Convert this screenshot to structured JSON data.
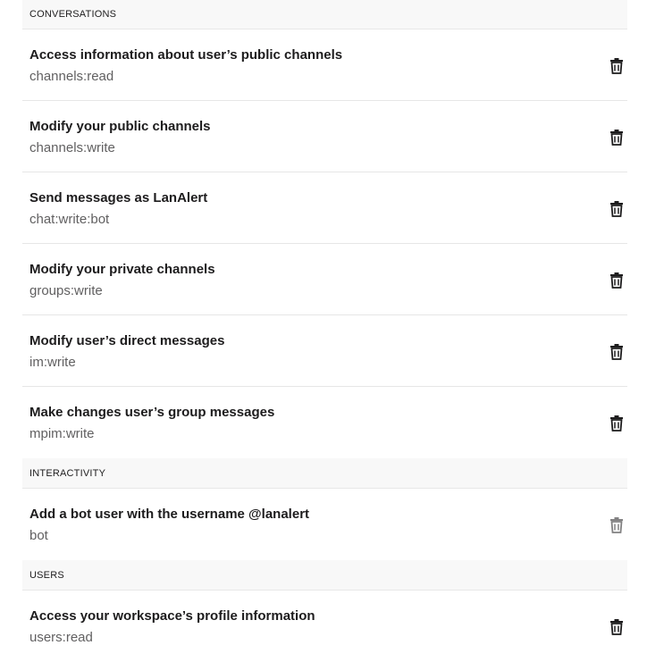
{
  "sections": [
    {
      "header": "CONVERSATIONS",
      "scopes": [
        {
          "title": "Access information about user’s public channels",
          "id": "channels:read",
          "icon": "trash-icon"
        },
        {
          "title": "Modify your public channels",
          "id": "channels:write",
          "icon": "trash-icon"
        },
        {
          "title": "Send messages as LanAlert",
          "id": "chat:write:bot",
          "icon": "trash-icon"
        },
        {
          "title": "Modify your private channels",
          "id": "groups:write",
          "icon": "trash-icon"
        },
        {
          "title": "Modify user’s direct messages",
          "id": "im:write",
          "icon": "trash-icon"
        },
        {
          "title": "Make changes user’s group messages",
          "id": "mpim:write",
          "icon": "trash-icon"
        }
      ]
    },
    {
      "header": "INTERACTIVITY",
      "scopes": [
        {
          "title": "Add a bot user with the username @lanalert",
          "id": "bot",
          "icon": "trash-icon",
          "disabled": true
        }
      ]
    },
    {
      "header": "USERS",
      "scopes": [
        {
          "title": "Access your workspace’s profile information",
          "id": "users:read",
          "icon": "trash-icon"
        }
      ]
    }
  ],
  "colors": {
    "header_bg": "#f8f8f8",
    "title_text": "#1d1c1d",
    "scope_id_text": "#616061",
    "icon": "#1d1c1d"
  }
}
